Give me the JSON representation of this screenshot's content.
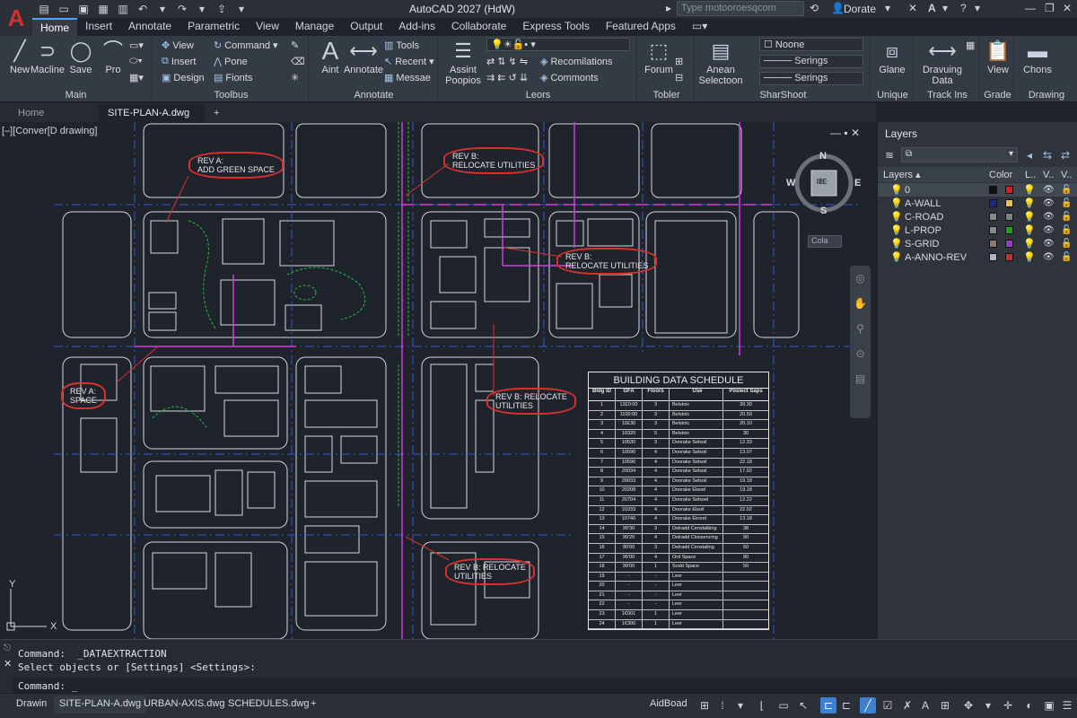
{
  "app": {
    "title": "AutoCAD 2027 (HdW)",
    "logo": "A",
    "search_placeholder": "Type motooroesqcom",
    "user": "Dorate"
  },
  "ribbon_tabs": [
    "Home",
    "Insert",
    "Annotate",
    "Parametric",
    "View",
    "Manage",
    "Output",
    "Add-ins",
    "Collaborate",
    "Express Tools",
    "Featured Apps"
  ],
  "ribbon": {
    "main": {
      "label": "Main",
      "new": "New",
      "machine": "Macline",
      "save": "Save",
      "pro": "Pro"
    },
    "toolbus": {
      "label": "Toolbus",
      "view": "View",
      "insert": "Insert",
      "design": "Design",
      "command": "Command",
      "pone": "Pone",
      "fionts": "Fionts"
    },
    "annotate": {
      "label": "Annotate",
      "aint": "Aint",
      "annotate": "Annotate",
      "tools": "Tools",
      "recent": "Recent",
      "message": "Messae"
    },
    "leors": {
      "label": "Leors",
      "assist": "Assint",
      "popups": "Poopios",
      "recommend": "Recomilations",
      "comments": "Commonts"
    },
    "tobler": {
      "label": "Tobler",
      "forum": "Forum"
    },
    "shareshoot": {
      "label": "SharShoot",
      "anean": "Anean",
      "selection": "Selectoon",
      "noone": "Noone",
      "settings1": "Serings",
      "settings2": "Serings"
    },
    "unique": {
      "label": "Unique",
      "glane": "Glane"
    },
    "trackins": {
      "label": "Track Ins",
      "drawing_data": "Dravuing Data"
    },
    "grade": {
      "label": "Grade",
      "view": "View"
    },
    "drawing": {
      "label": "Drawing",
      "chons": "Chons"
    }
  },
  "doc_tabs": [
    "Home",
    "SITE-PLAN-A.dwg"
  ],
  "viewport": {
    "label": "[–][Conver[D drawing]",
    "cola": "Cola"
  },
  "compass": {
    "n": "N",
    "s": "S",
    "e": "E",
    "w": "W",
    "center": "IⅡE"
  },
  "clouds": [
    {
      "text1": "REV A:",
      "text2": "ADD GREEN SPACE"
    },
    {
      "text1": "REV B:",
      "text2": "RELOCATE UTILITIES"
    },
    {
      "text1": "REV B:",
      "text2": "RELOCATE UTILITIES"
    },
    {
      "text1": "REV A:",
      "text2": "SPACE"
    },
    {
      "text1": "REV B: RELOCATE",
      "text2": "UTILITIES"
    },
    {
      "text1": "REV B: RELOCATE",
      "text2": "UTILITIES"
    }
  ],
  "schedule": {
    "title": "BUILDING DATA SCHEDULE",
    "headers": [
      "Bldg ID",
      "GFA",
      "Floors",
      "Use",
      "Poslect Saps"
    ],
    "rows": [
      [
        "1",
        "12£0:00",
        "3",
        "Belstoic",
        "39.30"
      ],
      [
        "2",
        "1100:00",
        "3",
        "Belstolc",
        "20.50"
      ],
      [
        "3",
        "10£30",
        "3",
        "Belstolc",
        "20.10"
      ],
      [
        "4",
        "10320",
        "5",
        "Belstoic",
        "30"
      ],
      [
        "5",
        "10530",
        "3",
        "Doorake Selsoil",
        "12.33"
      ],
      [
        "6",
        "10590",
        "4",
        "Doorake Selsoil",
        "13.07"
      ],
      [
        "7",
        "10590",
        "4",
        "Doorake Selsoil",
        "22.18"
      ],
      [
        "8",
        "20034",
        "4",
        "Doorake Selsoil",
        "17.02"
      ],
      [
        "9",
        "20033",
        "4",
        "Doorake Selsoil",
        "19.18"
      ],
      [
        "10",
        "20208",
        "4",
        "Doorake Elsoel",
        "19.18"
      ],
      [
        "11",
        "20704",
        "4",
        "Doorake Selsoel",
        "12.22"
      ],
      [
        "12",
        "31033",
        "4",
        "Doorake Elsoil",
        "22.02"
      ],
      [
        "13",
        "10740",
        "4",
        "Doorake Eirorel",
        "13.18"
      ],
      [
        "14",
        "99'30",
        "3",
        "Delradd Censtalking",
        "38"
      ],
      [
        "15",
        "99'20",
        "4",
        "Delradd Clossencing",
        "90"
      ],
      [
        "16",
        "90'00",
        "3",
        "Delradd Censtaling",
        "50"
      ],
      [
        "17",
        "95'00",
        "4",
        "Ord Space",
        "90"
      ],
      [
        "18",
        "99'00",
        "1",
        "Sodd Space",
        "50"
      ],
      [
        "19",
        "-",
        "-",
        "Leer",
        ""
      ],
      [
        "20",
        "-",
        "-",
        "Leer",
        ""
      ],
      [
        "21",
        "-",
        "-",
        "Leer",
        ""
      ],
      [
        "22",
        "-",
        "-",
        "Leer",
        ""
      ],
      [
        "23",
        "1€001",
        "1",
        "Leer",
        ""
      ],
      [
        "24",
        "1€300",
        "1",
        "Leer",
        ""
      ]
    ]
  },
  "layers": {
    "title": "Layers",
    "head_layers": "Layers",
    "head_color": "Color",
    "head_l": "L..",
    "head_v": "V..",
    "head_v2": "V..",
    "items": [
      {
        "name": "0",
        "color": "#111111",
        "color2": "#d42020"
      },
      {
        "name": "A-WALL",
        "color": "#1e2a8a",
        "color2": "#f0c040"
      },
      {
        "name": "C-ROAD",
        "color": "#8a8a8a",
        "color2": "#808080"
      },
      {
        "name": "L-PROP",
        "color": "#8a8a8a",
        "color2": "#20a020"
      },
      {
        "name": "S-GRID",
        "color": "#8a7a70",
        "color2": "#9040c0"
      },
      {
        "name": "A-ANNO-REV",
        "color": "#b0b0c8",
        "color2": "#c03030"
      }
    ]
  },
  "command": {
    "line1": "Command:  _DATAEXTRACTION",
    "line2": "Select objects or [Settings] <Settings>:",
    "prompt": "Command:  _"
  },
  "status_tabs": [
    "Drawin",
    "SITE-PLAN-A.dwg",
    "URBAN-AXIS.dwg",
    "SCHEDULES.dwg"
  ],
  "status_model": "AidBoad"
}
